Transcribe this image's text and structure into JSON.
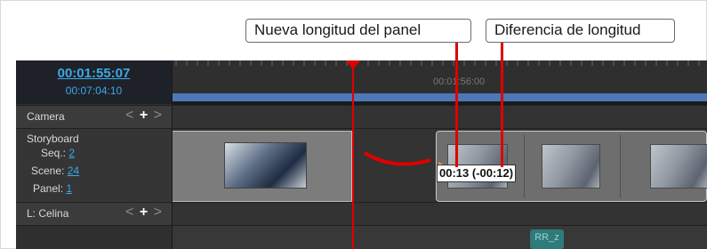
{
  "callouts": {
    "new_panel_length": "Nueva longitud del panel",
    "length_difference": "Diferencia de longitud"
  },
  "timecode": {
    "current": "00:01:55:07",
    "total": "00:07:04:10"
  },
  "ruler": {
    "time_label": "00:01:56:00"
  },
  "tracks": {
    "camera": {
      "label": "Camera",
      "prev_icon": "<",
      "add_icon": "+",
      "next_icon": ">"
    },
    "storyboard": {
      "title": "Storyboard",
      "seq_label": "Seq.:",
      "seq_value": "2",
      "scene_label": "Scene:",
      "scene_value": "24",
      "panel_label": "Panel:",
      "panel_value": "1"
    },
    "layer": {
      "label": "L: Celina",
      "prev_icon": "<",
      "add_icon": "+",
      "next_icon": ">"
    }
  },
  "timeline": {
    "tooltip": "00:13 (-00:12)",
    "clip_label": "RR_z"
  },
  "colors": {
    "accent": "#3aa9e8",
    "playhead": "#e00000",
    "ruler_band": "#4d78b5"
  }
}
